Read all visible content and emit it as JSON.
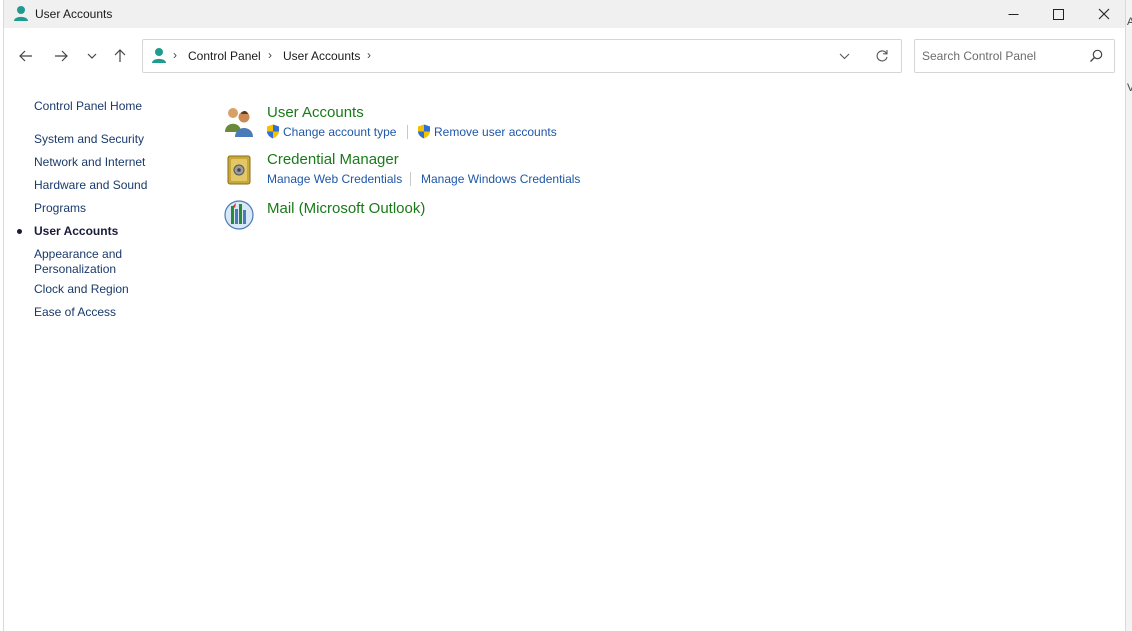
{
  "window": {
    "title": "User Accounts",
    "icon": "user-accounts-icon",
    "controls": {
      "minimize": "minimize-icon",
      "maximize": "maximize-icon",
      "close": "close-icon"
    }
  },
  "nav": {
    "back": "back-arrow-icon",
    "forward": "forward-arrow-icon",
    "recent": "chevron-down-icon",
    "up": "up-arrow-icon"
  },
  "address": {
    "crumbs": [
      "Control Panel",
      "User Accounts"
    ],
    "separator": "›"
  },
  "search": {
    "placeholder": "Search Control Panel"
  },
  "sidebar": {
    "home": "Control Panel Home",
    "items": [
      {
        "label": "System and Security",
        "active": false
      },
      {
        "label": "Network and Internet",
        "active": false
      },
      {
        "label": "Hardware and Sound",
        "active": false
      },
      {
        "label": "Programs",
        "active": false
      },
      {
        "label": "User Accounts",
        "active": true
      },
      {
        "label": "Appearance and",
        "label2": "Personalization",
        "active": false
      },
      {
        "label": "Clock and Region",
        "active": false
      },
      {
        "label": "Ease of Access",
        "active": false
      }
    ]
  },
  "categories": [
    {
      "title": "User Accounts",
      "icon": "users-icon",
      "tasks": [
        {
          "label": "Change account type",
          "shield": true
        },
        {
          "label": "Remove user accounts",
          "shield": true
        }
      ]
    },
    {
      "title": "Credential Manager",
      "icon": "credential-vault-icon",
      "tasks": [
        {
          "label": "Manage Web Credentials",
          "shield": false
        },
        {
          "label": "Manage Windows Credentials",
          "shield": false
        }
      ]
    },
    {
      "title": "Mail (Microsoft Outlook)",
      "icon": "mail-icon",
      "tasks": []
    }
  ],
  "colors": {
    "category_title": "#1a7a1a",
    "task_link": "#1f57a8",
    "sidebar_link": "#1a3a6b",
    "titlebar_bg": "#f0f0f0"
  },
  "edge_glyphs": [
    "A",
    "V"
  ]
}
